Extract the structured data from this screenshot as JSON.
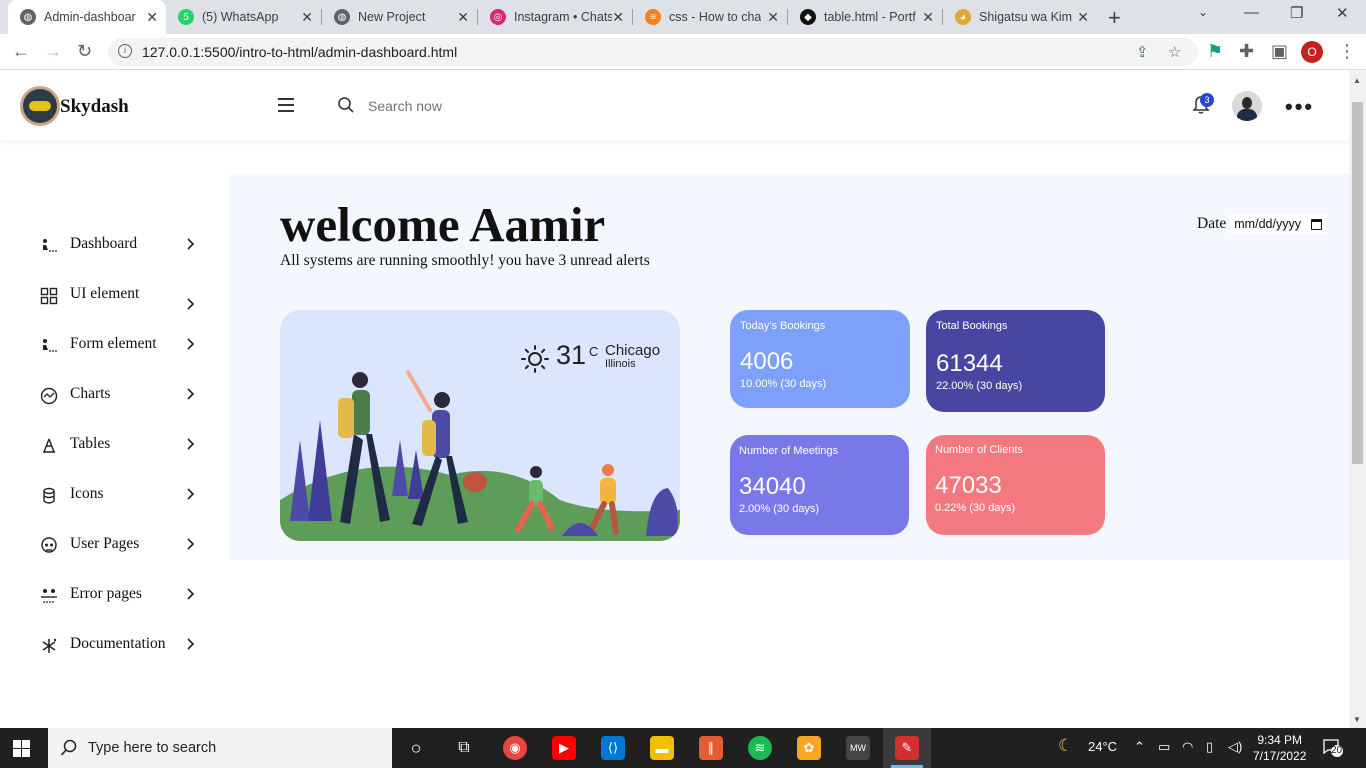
{
  "browser": {
    "tabs": [
      {
        "title": "Admin-dashboard",
        "favicon": "globe-icon",
        "active": true
      },
      {
        "title": "(5) WhatsApp",
        "favicon": "whatsapp-icon",
        "active": false
      },
      {
        "title": "New Project",
        "favicon": "globe-icon",
        "active": false
      },
      {
        "title": "Instagram • Chats",
        "favicon": "instagram-icon",
        "active": false
      },
      {
        "title": "css - How to chan",
        "favicon": "stackoverflow-icon",
        "active": false
      },
      {
        "title": "table.html - Portf",
        "favicon": "codepen-icon",
        "active": false
      },
      {
        "title": "Shigatsu wa Kimi",
        "favicon": "cat-icon",
        "active": false
      }
    ],
    "url": "127.0.0.1:5500/intro-to-html/admin-dashboard.html",
    "profile_initial": "O",
    "whatsapp_badge": "5"
  },
  "app": {
    "brand": "Skydash",
    "search_placeholder": "Search now",
    "notification_count": "3"
  },
  "sidebar": {
    "items": [
      {
        "label": "Dashboard",
        "icon": "dashboard-icon"
      },
      {
        "label": "UI element",
        "icon": "grid-icon"
      },
      {
        "label": "Form element",
        "icon": "form-icon"
      },
      {
        "label": "Charts",
        "icon": "chart-icon"
      },
      {
        "label": "Tables",
        "icon": "table-icon"
      },
      {
        "label": "Icons",
        "icon": "icons-icon"
      },
      {
        "label": "User Pages",
        "icon": "user-icon"
      },
      {
        "label": "Error pages",
        "icon": "error-icon"
      },
      {
        "label": "Documentation",
        "icon": "docs-icon"
      }
    ]
  },
  "main": {
    "welcome": "welcome Aamir",
    "subtitle": "All systems are running smoothly! you have 3 unread alerts",
    "date_label": "Date",
    "date_placeholder": "mm/dd/yyyy",
    "weather": {
      "temperature": "31",
      "unit": "C",
      "city": "Chicago",
      "region": "Illinois"
    },
    "stats": [
      {
        "label": "Today's Bookings",
        "value": "4006",
        "change": "10.00% (30 days)",
        "color": "#7da0fa"
      },
      {
        "label": "Total Bookings",
        "value": "61344",
        "change": "22.00% (30 days)",
        "color": "#4747a1"
      },
      {
        "label": "Number of Meetings",
        "value": "34040",
        "change": "2.00% (30 days)",
        "color": "#7978e9"
      },
      {
        "label": "Number of Clients",
        "value": "47033",
        "change": "0.22% (30 days)",
        "color": "#f3797e"
      }
    ]
  },
  "taskbar": {
    "search_placeholder": "Type here to search",
    "weather": "24°C",
    "time": "9:34 PM",
    "date": "7/17/2022",
    "notification_count": "20"
  }
}
